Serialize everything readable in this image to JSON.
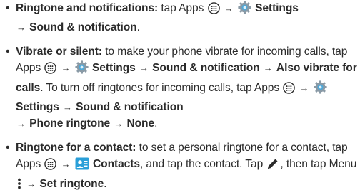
{
  "items": [
    {
      "title": "Ringtone and notifications:",
      "tap": "tap Apps",
      "settings": "Settings",
      "sound": "Sound & notification",
      "end": "."
    },
    {
      "title": "Vibrate or silent:",
      "intro": "to make your phone vibrate for incoming calls, tap Apps",
      "settings": "Settings",
      "sound": "Sound & notification",
      "also_vibrate": "Also vibrate for calls",
      "mid": ". To turn off ringtones for incoming calls, tap Apps",
      "settings2": "Settings",
      "sound2": "Sound & notification",
      "phone_ringtone": "Phone ringtone",
      "none": "None",
      "end": "."
    },
    {
      "title": "Ringtone for a contact:",
      "intro": "to set a personal ringtone for a contact, tap Apps",
      "contacts": "Contacts",
      "mid": ", and tap the contact. Tap",
      "then": ", then tap Menu",
      "set_ringtone": "Set ringtone",
      "end": "."
    }
  ],
  "arrow": "→",
  "bullet": "•",
  "icons": {
    "apps": "apps-grid-icon",
    "settings": "settings-gear-icon",
    "contacts": "contacts-icon",
    "edit": "pencil-edit-icon",
    "menu": "menu-dots-icon"
  }
}
